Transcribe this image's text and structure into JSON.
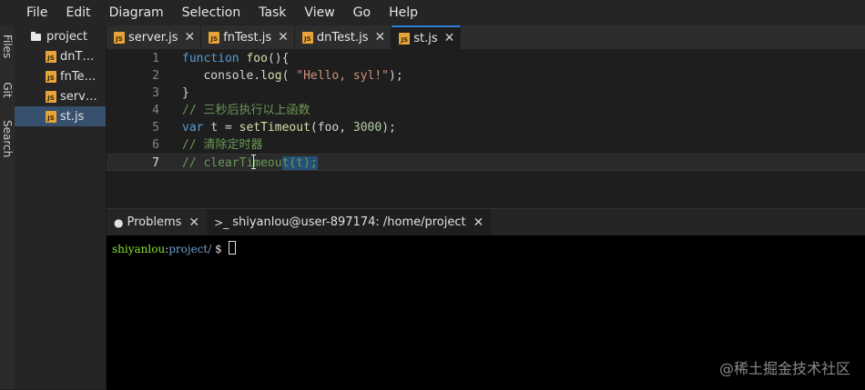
{
  "menu": [
    "File",
    "Edit",
    "Diagram",
    "Selection",
    "Task",
    "View",
    "Go",
    "Help"
  ],
  "activity_tabs": [
    "Files",
    "Git",
    "Search"
  ],
  "tree": {
    "root": "project",
    "items": [
      {
        "label": "dnTest.js",
        "display": "dnT…"
      },
      {
        "label": "fnTest.js",
        "display": "fnTe…"
      },
      {
        "label": "server.js",
        "display": "serv…"
      },
      {
        "label": "st.js",
        "display": "st.js",
        "selected": true
      }
    ]
  },
  "tabs": [
    {
      "label": "server.js"
    },
    {
      "label": "fnTest.js"
    },
    {
      "label": "dnTest.js"
    },
    {
      "label": "st.js",
      "active": true
    }
  ],
  "editor": {
    "current_line": 7,
    "lines": [
      {
        "n": "1",
        "tokens": [
          {
            "t": "function ",
            "c": "kw"
          },
          {
            "t": "foo",
            "c": "fn"
          },
          {
            "t": "(){",
            "c": "plain"
          }
        ]
      },
      {
        "n": "2",
        "tokens": [
          {
            "t": "   console",
            "c": "plain"
          },
          {
            "t": ".",
            "c": "plain"
          },
          {
            "t": "log",
            "c": "fn"
          },
          {
            "t": "( ",
            "c": "plain"
          },
          {
            "t": "\"Hello, syl!\"",
            "c": "str"
          },
          {
            "t": ");",
            "c": "plain"
          }
        ]
      },
      {
        "n": "3",
        "tokens": [
          {
            "t": "}",
            "c": "plain"
          }
        ]
      },
      {
        "n": "4",
        "tokens": [
          {
            "t": "// 三秒后执行以上函数",
            "c": "cmt"
          }
        ]
      },
      {
        "n": "5",
        "tokens": [
          {
            "t": "var ",
            "c": "kw"
          },
          {
            "t": "t = ",
            "c": "plain"
          },
          {
            "t": "setTimeout",
            "c": "fn"
          },
          {
            "t": "(foo, ",
            "c": "plain"
          },
          {
            "t": "3000",
            "c": "num"
          },
          {
            "t": ");",
            "c": "plain"
          }
        ]
      },
      {
        "n": "6",
        "tokens": [
          {
            "t": "// 清除定时器",
            "c": "cmt"
          }
        ]
      },
      {
        "n": "7",
        "tokens": [
          {
            "t": "// clearTimeou",
            "c": "cmt"
          },
          {
            "t": "t(t);",
            "c": "cmt sel"
          }
        ]
      }
    ]
  },
  "panel": {
    "tabs": [
      {
        "icon": "●",
        "label": "Problems"
      },
      {
        "icon": ">_",
        "label": "shiyanlou@user-897174: /home/project",
        "active": true
      }
    ],
    "terminal": {
      "user": "shiyanlou",
      "sep": ":",
      "path": "project/",
      "prompt": " $ "
    }
  },
  "watermark": "@稀土掘金技术社区",
  "icons": {
    "close": "✕",
    "folder": "folder-icon",
    "js": "JS"
  }
}
